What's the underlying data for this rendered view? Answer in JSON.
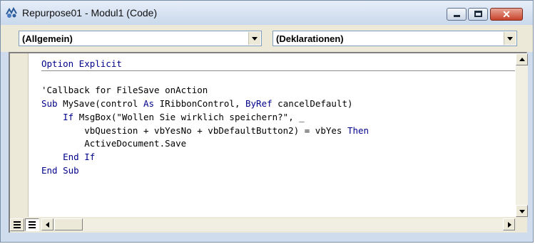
{
  "window": {
    "title": "Repurpose01 - Modul1 (Code)",
    "icon": "vba-module-icon",
    "close_glyph": "✕"
  },
  "toolbar": {
    "object_combo": "(Allgemein)",
    "procedure_combo": "(Deklarationen)"
  },
  "code": {
    "lines": [
      [
        {
          "t": "Option Explicit",
          "c": "kw"
        }
      ],
      [],
      [
        {
          "t": "'Callback for FileSave onAction",
          "c": "comment"
        }
      ],
      [
        {
          "t": "Sub",
          "c": "kw"
        },
        {
          "t": " MySave(control "
        },
        {
          "t": "As",
          "c": "kw"
        },
        {
          "t": " IRibbonControl, "
        },
        {
          "t": "ByRef",
          "c": "kw"
        },
        {
          "t": " cancelDefault)"
        }
      ],
      [
        {
          "t": "    "
        },
        {
          "t": "If",
          "c": "kw"
        },
        {
          "t": " MsgBox(\"Wollen Sie wirklich speichern?\", _"
        }
      ],
      [
        {
          "t": "        vbQuestion + vbYesNo + vbDefaultButton2) = vbYes "
        },
        {
          "t": "Then",
          "c": "kw"
        }
      ],
      [
        {
          "t": "        ActiveDocument.Save"
        }
      ],
      [
        {
          "t": "    "
        },
        {
          "t": "End If",
          "c": "kw"
        }
      ],
      [
        {
          "t": "End Sub",
          "c": "kw"
        }
      ]
    ]
  },
  "colors": {
    "keyword": "#00008b",
    "comment": "#008000",
    "text": "#000000",
    "title_gradient_top": "#e7eef8",
    "close_button": "#c7432a"
  }
}
